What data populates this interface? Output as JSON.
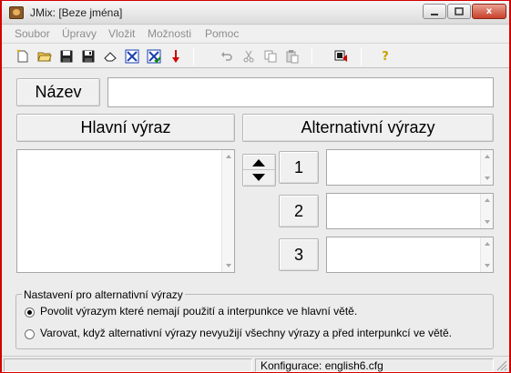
{
  "window": {
    "title": "JMix: [Beze jména]",
    "close_label": "x"
  },
  "menu": {
    "items": [
      "Soubor",
      "Úpravy",
      "Vložit",
      "Možnosti",
      "Pomoc"
    ]
  },
  "toolbar": {
    "icons": [
      "new-file-icon",
      "open-folder-icon",
      "save-icon",
      "save-as-icon",
      "eraser-icon",
      "check-icon",
      "check-all-icon",
      "down-arrow-icon",
      "undo-icon",
      "cut-icon",
      "copy-icon",
      "paste-icon",
      "font-icon",
      "help-icon"
    ],
    "help_label": "?"
  },
  "form": {
    "name_label": "Název",
    "name_value": "",
    "main_header": "Hlavní výraz",
    "alt_header": "Alternativní výrazy",
    "alt_buttons": [
      "1",
      "2",
      "3"
    ]
  },
  "options": {
    "legend": "Nastavení pro alternativní výrazy",
    "radio1": "Povolit výrazym které nemají použití a interpunkce ve hlavní větě.",
    "radio2": "Varovat, když alternativní výrazy nevyužijí všechny výrazy a před interpunkcí ve větě.",
    "selected": 1
  },
  "status": {
    "config": "Konfigurace: english6.cfg"
  }
}
